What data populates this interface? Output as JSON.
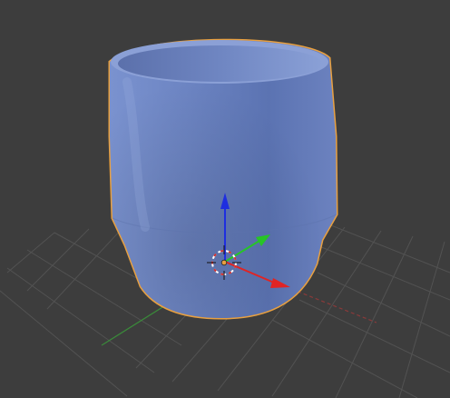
{
  "viewport": {
    "background": "#3d3d3d",
    "grid_color": "#555555",
    "x_axis_color": "#8a3a3a",
    "y_axis_color": "#3a8a3a"
  },
  "object": {
    "name": "cup-mesh",
    "fill": "#6f86c4",
    "selection_outline": "#e8a040"
  },
  "gizmo": {
    "x_axis_color": "#e02424",
    "y_axis_color": "#27c427",
    "z_axis_color": "#1e2ee0",
    "origin_color": "#e8a040",
    "cursor_color": "#ffffff"
  }
}
